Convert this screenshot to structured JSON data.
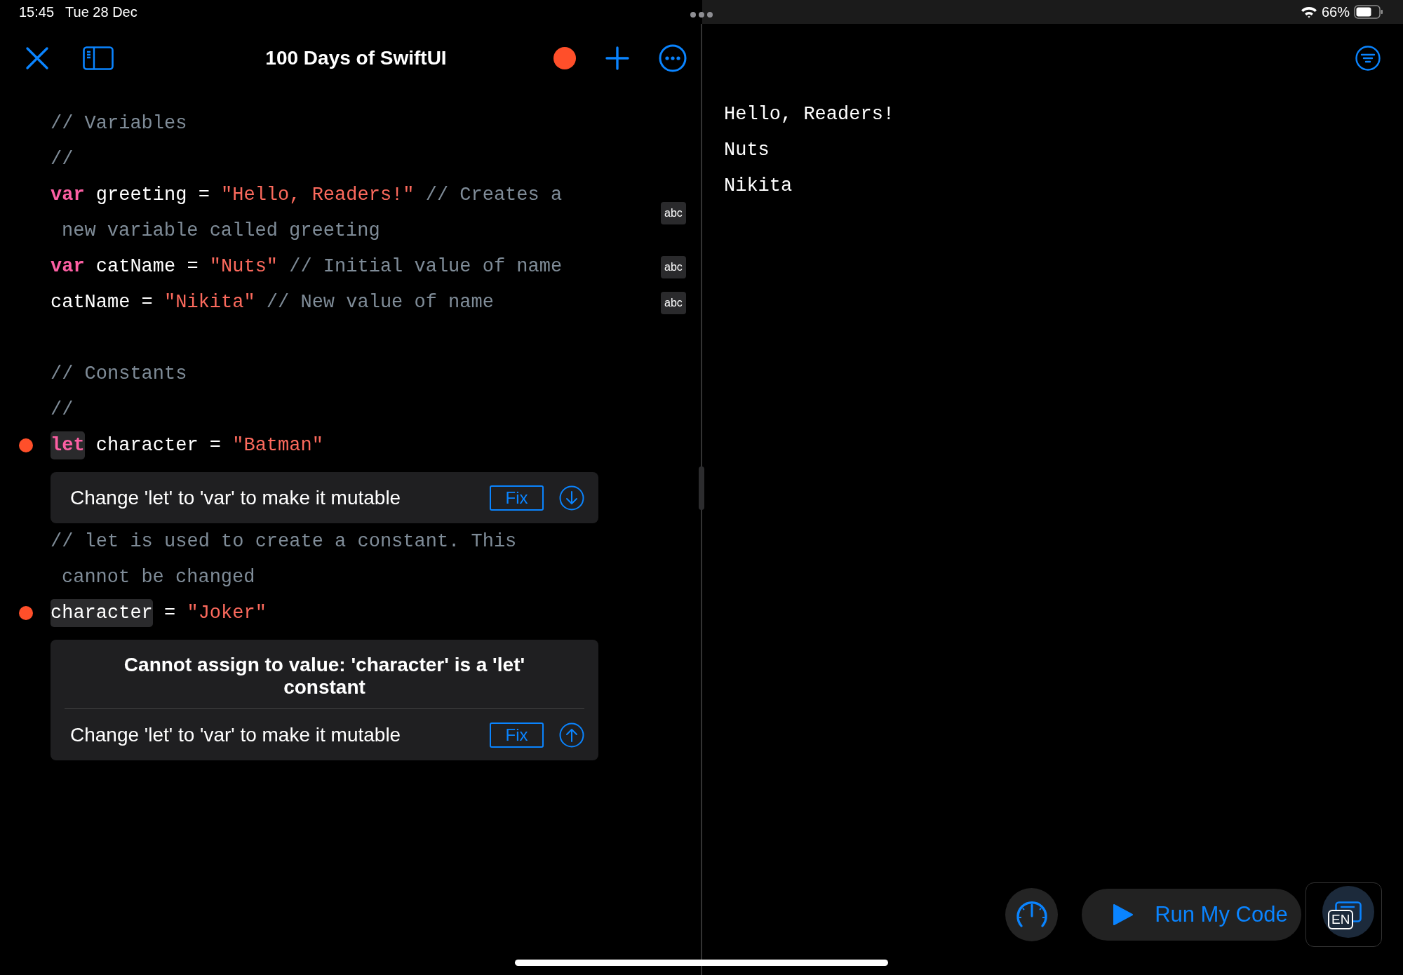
{
  "status_bar": {
    "time": "15:45",
    "date": "Tue 28 Dec",
    "battery_text": "66%"
  },
  "toolbar": {
    "title": "100 Days of SwiftUI"
  },
  "editor": {
    "lines": [
      {
        "kind": "code",
        "breakpoint": false,
        "rows": [
          [
            {
              "kind": "comment",
              "text": "// Variables",
              "highlighted": false
            }
          ]
        ]
      },
      {
        "kind": "code",
        "breakpoint": false,
        "rows": [
          [
            {
              "kind": "comment",
              "text": "//",
              "highlighted": false
            }
          ]
        ]
      },
      {
        "kind": "code",
        "breakpoint": false,
        "badge": "abc",
        "rows": [
          [
            {
              "kind": "keyword",
              "text": "var",
              "highlighted": false
            },
            {
              "kind": "plain",
              "text": " greeting = ",
              "highlighted": false
            },
            {
              "kind": "string",
              "text": "\"Hello, Readers!\"",
              "highlighted": false
            },
            {
              "kind": "comment",
              "text": " // Creates a",
              "highlighted": false
            }
          ],
          [
            {
              "kind": "comment",
              "text": "new variable called greeting",
              "highlighted": false
            }
          ]
        ]
      },
      {
        "kind": "code",
        "breakpoint": false,
        "badge": "abc",
        "rows": [
          [
            {
              "kind": "keyword",
              "text": "var",
              "highlighted": false
            },
            {
              "kind": "plain",
              "text": " catName = ",
              "highlighted": false
            },
            {
              "kind": "string",
              "text": "\"Nuts\"",
              "highlighted": false
            },
            {
              "kind": "comment",
              "text": " // Initial value of name",
              "highlighted": false
            }
          ]
        ]
      },
      {
        "kind": "code",
        "breakpoint": false,
        "badge": "abc",
        "rows": [
          [
            {
              "kind": "plain",
              "text": "catName = ",
              "highlighted": false
            },
            {
              "kind": "string",
              "text": "\"Nikita\"",
              "highlighted": false
            },
            {
              "kind": "comment",
              "text": " // New value of name",
              "highlighted": false
            }
          ]
        ]
      },
      {
        "kind": "blank"
      },
      {
        "kind": "code",
        "breakpoint": false,
        "rows": [
          [
            {
              "kind": "comment",
              "text": "// Constants",
              "highlighted": false
            }
          ]
        ]
      },
      {
        "kind": "code",
        "breakpoint": false,
        "rows": [
          [
            {
              "kind": "comment",
              "text": "//",
              "highlighted": false
            }
          ]
        ]
      },
      {
        "kind": "code",
        "breakpoint": true,
        "rows": [
          [
            {
              "kind": "keyword",
              "text": "let",
              "highlighted": true
            },
            {
              "kind": "plain",
              "text": " character = ",
              "highlighted": false
            },
            {
              "kind": "string",
              "text": "\"Batman\"",
              "highlighted": false
            }
          ]
        ]
      },
      {
        "kind": "diagnostic",
        "fix_text": "Change 'let' to 'var' to make it mutable",
        "fix_button": "Fix",
        "arrow_down": true
      },
      {
        "kind": "code",
        "breakpoint": false,
        "rows": [
          [
            {
              "kind": "comment",
              "text": "// let is used to create a constant. This",
              "highlighted": false
            }
          ],
          [
            {
              "kind": "comment",
              "text": "cannot be changed",
              "highlighted": false
            }
          ]
        ]
      },
      {
        "kind": "code",
        "breakpoint": true,
        "rows": [
          [
            {
              "kind": "plain",
              "text": "character",
              "highlighted": true
            },
            {
              "kind": "plain",
              "text": " = ",
              "highlighted": false
            },
            {
              "kind": "string",
              "text": "\"Joker\"",
              "highlighted": false
            }
          ]
        ]
      },
      {
        "kind": "diagnostic",
        "title": "Cannot assign to value: 'character' is a 'let' constant",
        "fix_text": "Change 'let' to 'var' to make it mutable",
        "fix_button": "Fix",
        "arrow_down": false
      }
    ]
  },
  "output": {
    "lines": [
      "Hello, Readers!",
      "Nuts",
      "Nikita"
    ]
  },
  "run_button": {
    "label": "Run My Code"
  },
  "language_button": {
    "label": "EN"
  }
}
